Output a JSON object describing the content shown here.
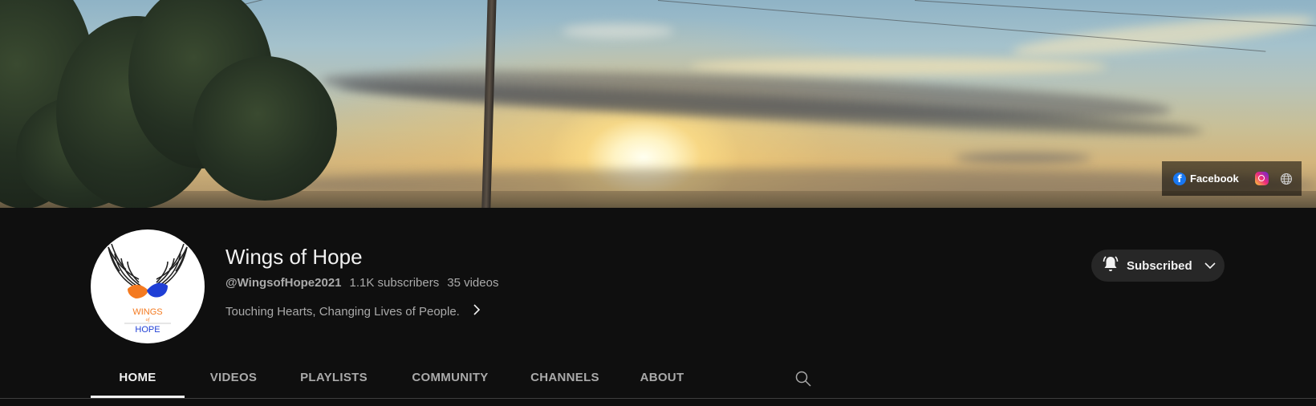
{
  "channel": {
    "name": "Wings of Hope",
    "handle": "@WingsofHope2021",
    "subscribers": "1.1K subscribers",
    "videos": "35 videos",
    "description": "Touching Hearts, Changing Lives of People.",
    "avatar_logo": {
      "line1": "WINGS",
      "line2": "of",
      "line3": "HOPE"
    }
  },
  "banner_links": {
    "facebook_label": "Facebook",
    "icons": [
      "facebook-icon",
      "instagram-icon",
      "globe-icon"
    ]
  },
  "subscribe": {
    "label": "Subscribed",
    "icon": "bell-icon"
  },
  "tabs": [
    {
      "label": "HOME",
      "active": true
    },
    {
      "label": "VIDEOS",
      "active": false
    },
    {
      "label": "PLAYLISTS",
      "active": false
    },
    {
      "label": "COMMUNITY",
      "active": false
    },
    {
      "label": "CHANNELS",
      "active": false
    },
    {
      "label": "ABOUT",
      "active": false
    }
  ],
  "colors": {
    "background": "#0f0f0f",
    "text_primary": "#f1f1f1",
    "text_secondary": "#aaaaaa",
    "button_bg": "#272727",
    "logo_orange": "#f47a20",
    "logo_blue": "#1f3fd6"
  }
}
